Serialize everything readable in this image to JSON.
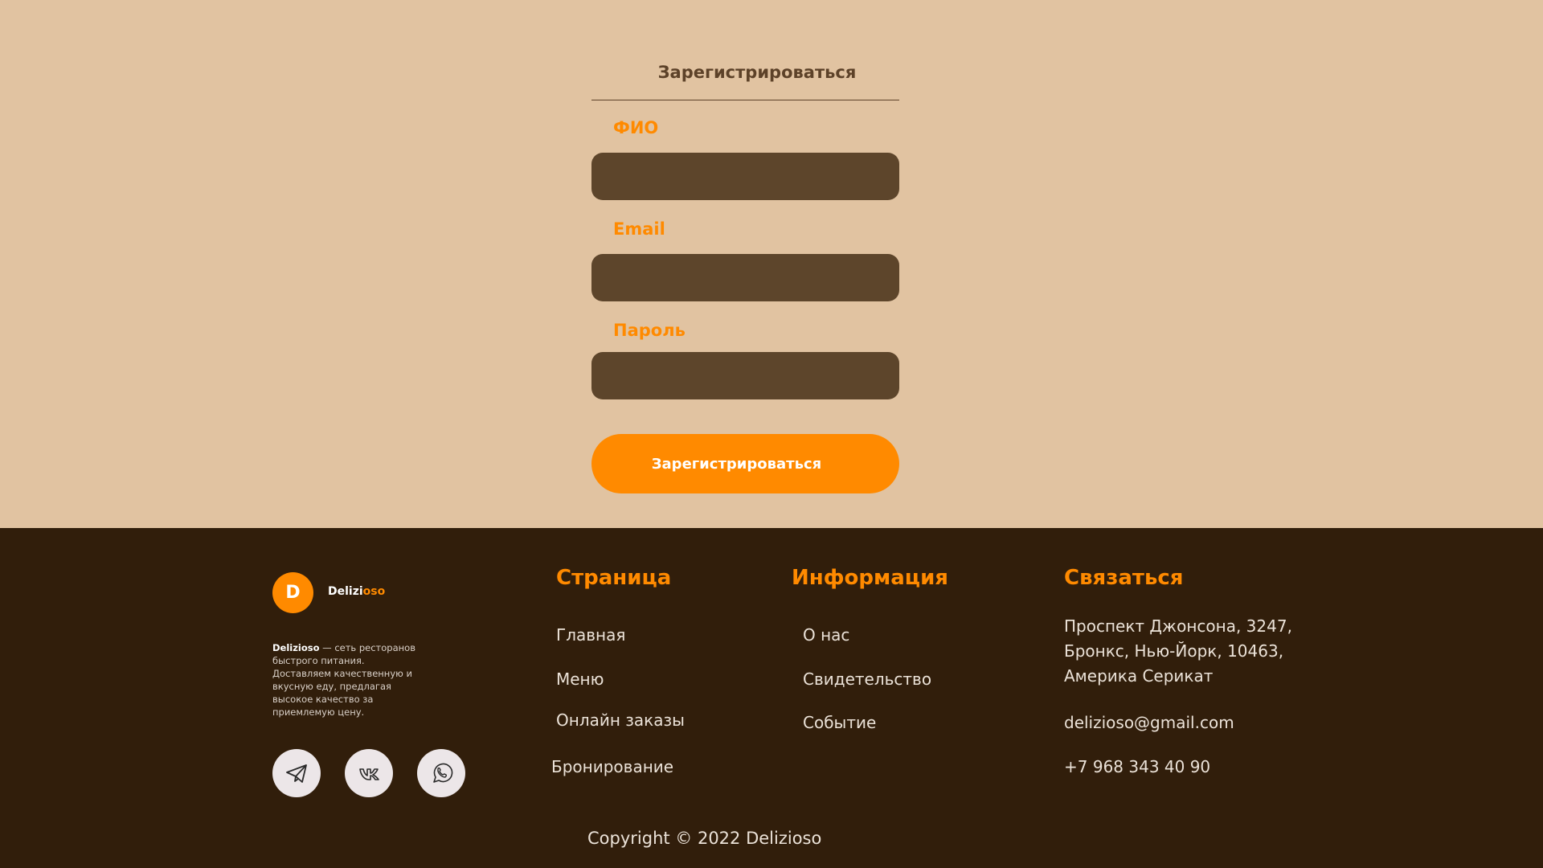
{
  "form": {
    "title": "Зарегистрироваться",
    "fields": {
      "name": {
        "label": "ФИО",
        "value": "",
        "placeholder": ""
      },
      "email": {
        "label": "Email",
        "value": "",
        "placeholder": ""
      },
      "password": {
        "label": "Пароль",
        "value": "",
        "placeholder": ""
      }
    },
    "submit_label": "Зарегистрироваться"
  },
  "footer": {
    "logo_letter": "D",
    "brand_main": "Delizi",
    "brand_accent": "oso",
    "desc_brand": "Delizioso",
    "desc_text": " — сеть ресторанов быстрого питания. Доставляем качественную и вкусную еду, предлагая высокое качество за приемлемую цену.",
    "social": [
      "telegram-icon",
      "vk-icon",
      "whatsapp-icon"
    ],
    "pages": {
      "heading": "Страница",
      "items": [
        "Главная",
        "Меню",
        "Онлайн заказы",
        "Бронирование"
      ]
    },
    "info": {
      "heading": "Информация",
      "items": [
        "О нас",
        "Свидетельство",
        "Событие"
      ]
    },
    "contact": {
      "heading": "Связаться",
      "address_lines": [
        "Проспект Джонсона, 3247,",
        "Бронкс, Нью-Йорк, 10463,",
        "Америка Серикат"
      ],
      "email": "delizioso@gmail.com",
      "phone": "+7 968 343 40 90"
    },
    "copyright": "Copyright © 2022 Delizioso"
  },
  "colors": {
    "form_bg": "#e1c3a1",
    "input_bg": "#5d452b",
    "accent": "#ff8a00",
    "footer_bg": "#311e0b"
  }
}
